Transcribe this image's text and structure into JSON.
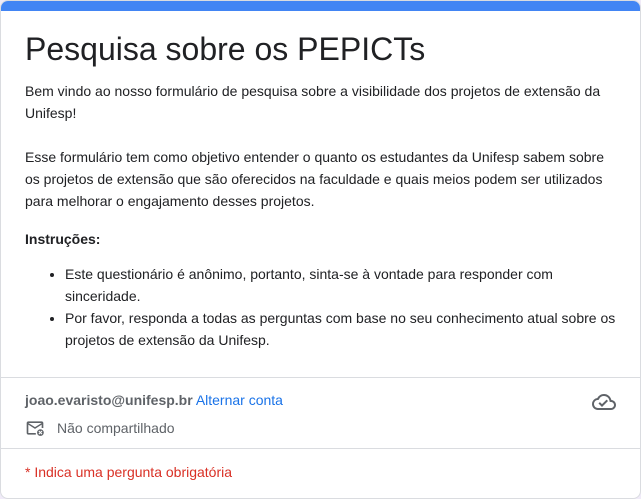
{
  "form": {
    "title": "Pesquisa sobre os PEPICTs",
    "accent_color": "#4285f4",
    "description": {
      "paragraph1": "Bem vindo ao nosso formulário de pesquisa sobre a visibilidade dos projetos de extensão da Unifesp!",
      "paragraph2": "Esse formulário tem como objetivo entender o quanto os estudantes da Unifesp sabem sobre os projetos de extensão que são oferecidos na faculdade e quais meios podem ser utilizados para melhorar o engajamento desses projetos.",
      "instructions_heading": "Instruções:",
      "instructions": [
        "Este questionário é anônimo, portanto, sinta-se à vontade para responder com sinceridade.",
        "Por favor, responda a todas as perguntas com base no seu conhecimento atual sobre os projetos de extensão da Unifesp."
      ]
    }
  },
  "account": {
    "email": "joao.evaristo@unifesp.br",
    "switch_label": "Alternar conta",
    "sharing_status": "Não compartilhado",
    "cloud_icon": "cloud-done-icon",
    "mail_icon": "mail-off-icon"
  },
  "required_note": "* Indica uma pergunta obrigatória"
}
